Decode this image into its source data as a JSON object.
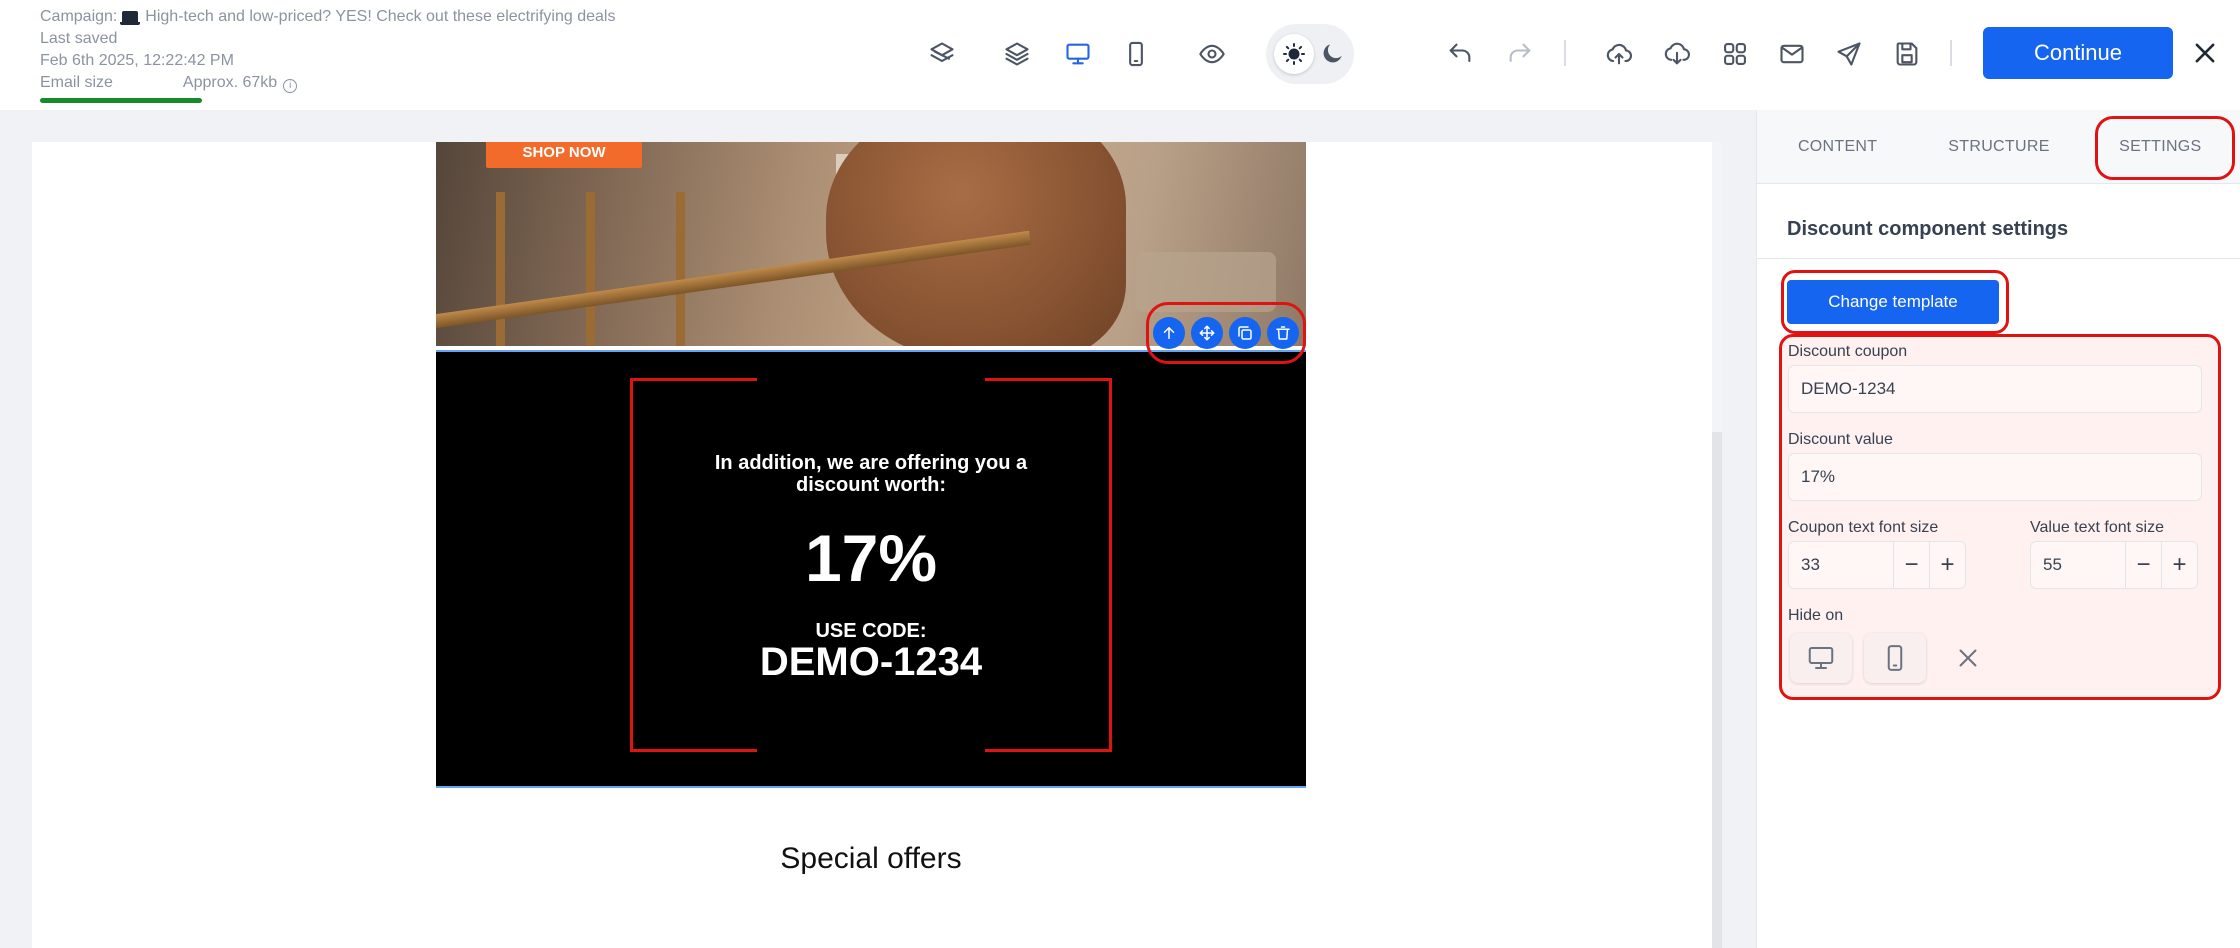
{
  "header": {
    "campaign_label": "Campaign:",
    "campaign_name": "High-tech and low-priced? YES! Check out these electrifying deals",
    "last_saved_label": "Last saved",
    "last_saved_time": "Feb 6th 2025, 12:22:42 PM",
    "email_size_label": "Email size",
    "email_size_value": "Approx. 67kb",
    "size_bar_color": "#178a2a",
    "continue_label": "Continue"
  },
  "toolbar_icons": [
    "layers-outline-icon",
    "layers-icon",
    "desktop-icon",
    "mobile-icon",
    "eye-icon",
    "sun-icon",
    "moon-icon",
    "undo-icon",
    "redo-icon",
    "upload-icon",
    "download-icon",
    "grid-icon",
    "mail-icon",
    "send-icon",
    "save-icon",
    "close-icon"
  ],
  "email": {
    "shop_now_label": "SHOP NOW",
    "discount_intro": "In addition, we are offering you a discount worth:",
    "discount_value": "17%",
    "use_code_label": "USE CODE:",
    "coupon_code": "DEMO-1234",
    "section_heading": "Special offers"
  },
  "panel": {
    "tabs": [
      "CONTENT",
      "STRUCTURE",
      "SETTINGS"
    ],
    "active_tab": "SETTINGS",
    "title": "Discount component settings",
    "change_template_label": "Change template",
    "discount_coupon_label": "Discount coupon",
    "discount_coupon_value": "DEMO-1234",
    "discount_value_label": "Discount value",
    "discount_value_value": "17%",
    "coupon_font_label": "Coupon text font size",
    "coupon_font_value": "33",
    "value_font_label": "Value text font size",
    "value_font_value": "55",
    "minus": "−",
    "plus": "+",
    "hide_on_label": "Hide on"
  },
  "colors": {
    "accent": "#1565f0",
    "highlight": "#e01313",
    "discount_bg": "#000000",
    "shop_now_bg": "#f26b2a"
  }
}
